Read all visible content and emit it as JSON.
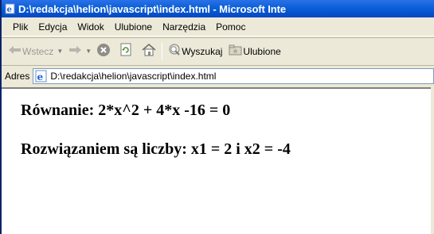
{
  "window": {
    "title": "D:\\redakcja\\helion\\javascript\\index.html - Microsoft Inte"
  },
  "menu": {
    "items": [
      "Plik",
      "Edycja",
      "Widok",
      "Ulubione",
      "Narzędzia",
      "Pomoc"
    ]
  },
  "toolbar": {
    "back_label": "Wstecz",
    "search_label": "Wyszukaj",
    "favorites_label": "Ulubione"
  },
  "address": {
    "label": "Adres",
    "url": "D:\\redakcja\\helion\\javascript\\index.html"
  },
  "content": {
    "equation": "Równanie: 2*x^2 + 4*x -16 = 0",
    "solution": "Rozwiązaniem są liczby: x1 = 2 i x2 = -4"
  },
  "colors": {
    "titlebar": "#0a5fd8",
    "chrome": "#ece9d8"
  }
}
